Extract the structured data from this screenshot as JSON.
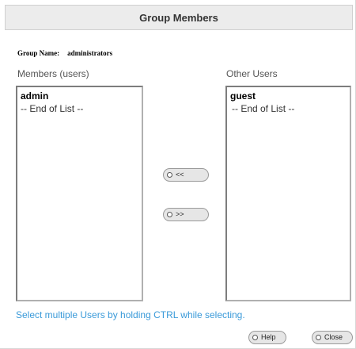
{
  "dialog": {
    "title": "Group Members"
  },
  "group": {
    "label": "Group Name:",
    "value": "administrators"
  },
  "members": {
    "label": "Members (users)",
    "items": [
      "admin",
      "-- End of List --"
    ]
  },
  "others": {
    "label": "Other Users",
    "items": [
      "guest",
      "-- End of List --"
    ]
  },
  "buttons": {
    "move_left": "<<",
    "move_right": ">>",
    "help": "Help",
    "close": "Close"
  },
  "hint": "Select multiple Users by holding CTRL while selecting.",
  "colors": {
    "hint": "#3a9ad9",
    "title_bg": "#ececec"
  }
}
